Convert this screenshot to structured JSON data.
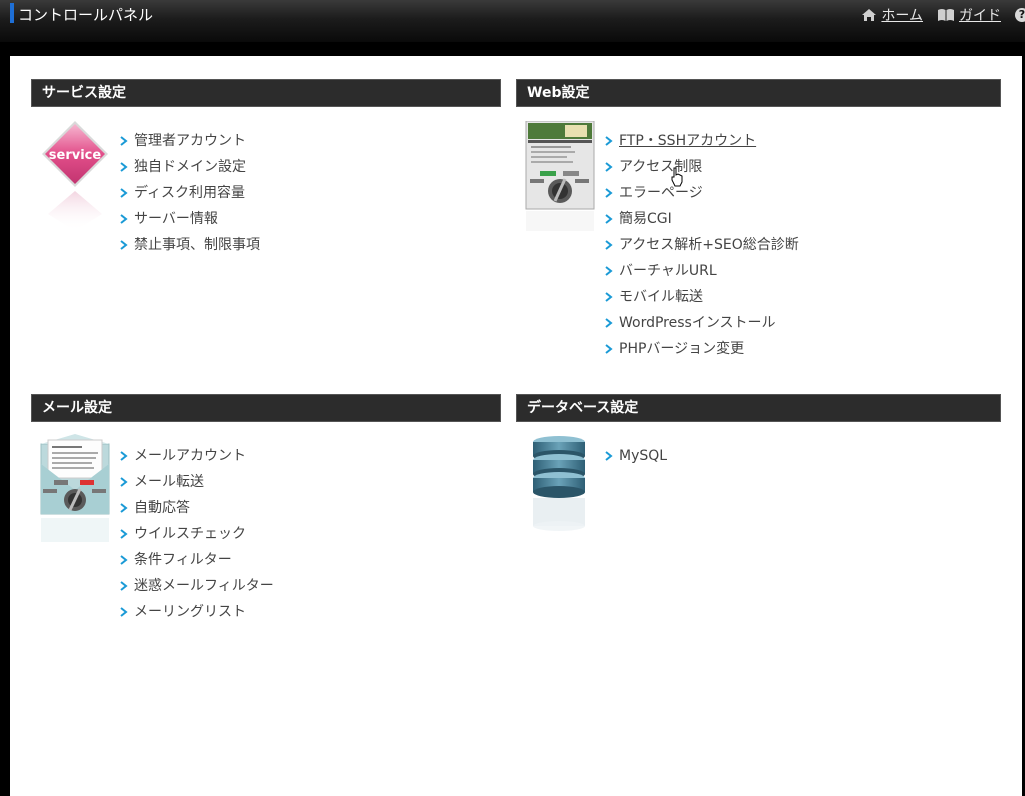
{
  "header": {
    "title": "コントロールパネル",
    "links": [
      {
        "label": "ホーム",
        "icon": "home-icon"
      },
      {
        "label": "ガイド",
        "icon": "book-icon"
      }
    ],
    "help_icon": "help-icon"
  },
  "panels": {
    "service": {
      "title": "サービス設定",
      "thumb_label": "service",
      "items": [
        "管理者アカウント",
        "独自ドメイン設定",
        "ディスク利用容量",
        "サーバー情報",
        "禁止事項、制限事項"
      ]
    },
    "web": {
      "title": "Web設定",
      "items": [
        "FTP・SSHアカウント",
        "アクセス制限",
        "エラーページ",
        "簡易CGI",
        "アクセス解析+SEO総合診断",
        "バーチャルURL",
        "モバイル転送",
        "WordPressインストール",
        "PHPバージョン変更"
      ]
    },
    "mail": {
      "title": "メール設定",
      "items": [
        "メールアカウント",
        "メール転送",
        "自動応答",
        "ウイルスチェック",
        "条件フィルター",
        "迷惑メールフィルター",
        "メーリングリスト"
      ]
    },
    "db": {
      "title": "データベース設定",
      "items": [
        "MySQL"
      ]
    }
  },
  "colors": {
    "accent": "#1e6fd6",
    "arrow": "#1a9ad6",
    "panel_header": "#2c2c2c"
  }
}
